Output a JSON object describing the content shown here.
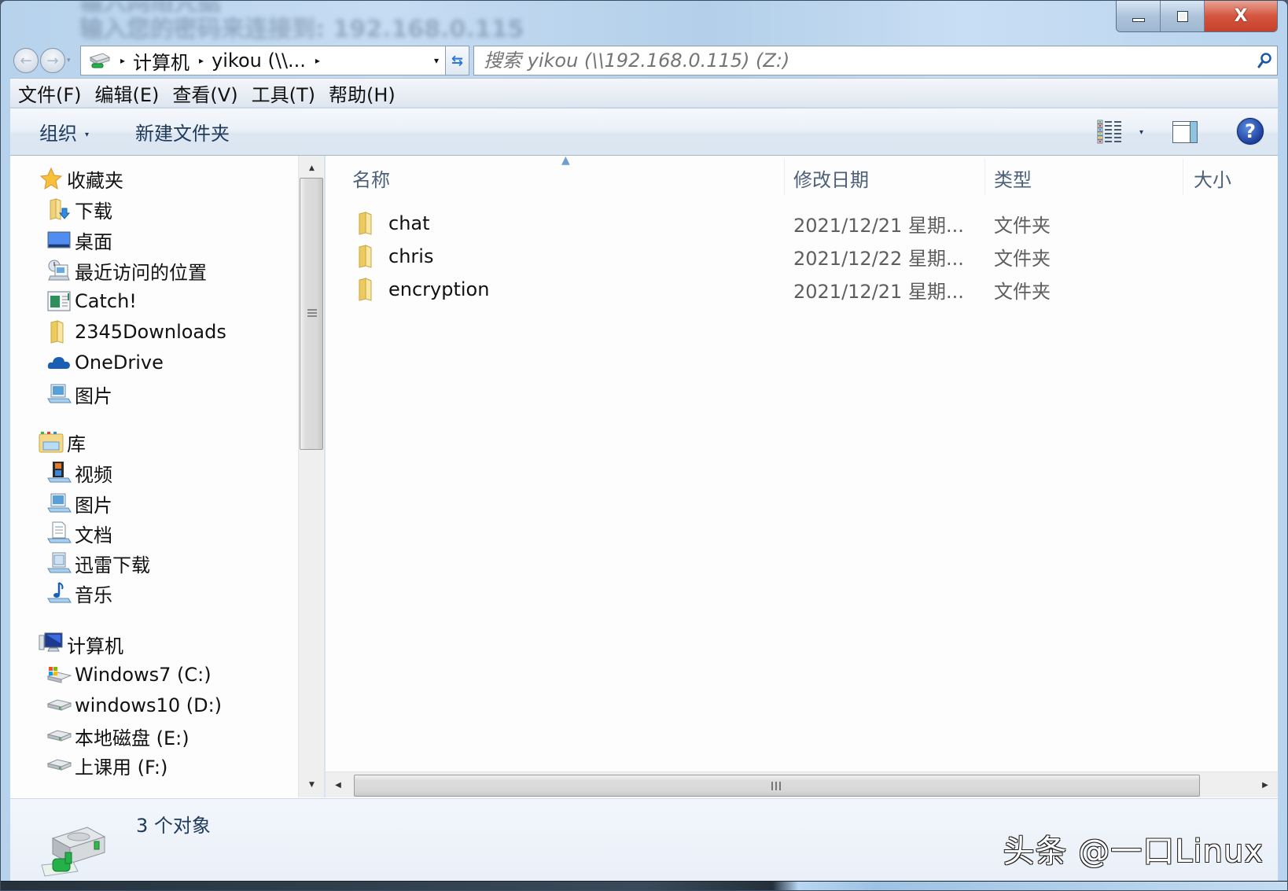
{
  "window": {
    "background_text_line1": "输入网络凭据",
    "background_text_line2": "输入您的密码来连接到: 192.168.0.115",
    "caption": {
      "minimize_icon": "minimize-icon",
      "maximize_icon": "maximize-icon",
      "close_glyph": "X"
    }
  },
  "navigation": {
    "back_icon": "←",
    "forward_icon": "→",
    "history_dropdown_icon": "▾",
    "address": {
      "icon": "network-drive-icon",
      "crumbs": [
        "计算机",
        "yikou (\\\\..."
      ],
      "separator": "▸",
      "dropdown_icon": "▾"
    },
    "refresh_icon": "⇆",
    "search": {
      "placeholder": "搜索 yikou (\\\\192.168.0.115) (Z:)",
      "value": ""
    }
  },
  "menubar": {
    "items": [
      "文件(F)",
      "编辑(E)",
      "查看(V)",
      "工具(T)",
      "帮助(H)"
    ]
  },
  "toolbar": {
    "organize_label": "组织",
    "organize_dd": "▾",
    "new_folder_label": "新建文件夹",
    "view_dd": "▾",
    "help_glyph": "?"
  },
  "nav_pane": {
    "favorites": {
      "label": "收藏夹",
      "items": [
        "下载",
        "桌面",
        "最近访问的位置",
        "Catch!",
        "2345Downloads",
        "OneDrive",
        "图片"
      ]
    },
    "libraries": {
      "label": "库",
      "items": [
        "视频",
        "图片",
        "文档",
        "迅雷下载",
        "音乐"
      ]
    },
    "computer": {
      "label": "计算机",
      "items": [
        "Windows7 (C:)",
        "windows10 (D:)",
        "本地磁盘 (E:)",
        "上课用 (F:)"
      ]
    },
    "scroll_up": "▲",
    "scroll_down": "▼"
  },
  "file_list": {
    "columns": [
      "名称",
      "修改日期",
      "类型",
      "大小"
    ],
    "sort_indicator": "▲",
    "rows": [
      {
        "name": "chat",
        "modified": "2021/12/21 星期...",
        "type": "文件夹",
        "size": ""
      },
      {
        "name": "chris",
        "modified": "2021/12/22 星期...",
        "type": "文件夹",
        "size": ""
      },
      {
        "name": "encryption",
        "modified": "2021/12/21 星期...",
        "type": "文件夹",
        "size": ""
      }
    ],
    "scroll_left": "◀",
    "scroll_right": "▶"
  },
  "details": {
    "count": "3 个对象"
  },
  "watermark": "头条 @一口Linux",
  "colors": {
    "accent_text": "#1e395b",
    "close_red": "#d5553f",
    "folder_yellow": "#f2d46b"
  }
}
